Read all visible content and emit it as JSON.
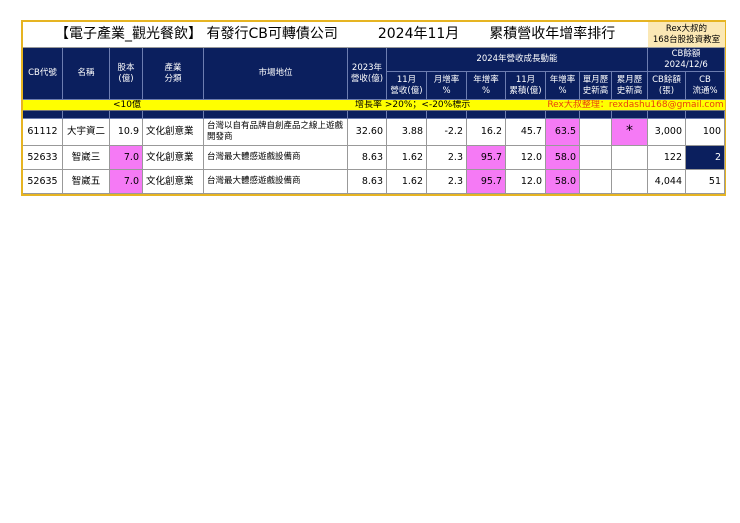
{
  "title": {
    "main": "【電子產業_觀光餐飲】 有發行CB可轉債公司",
    "period": "2024年11月",
    "subtitle": "累積營收年增率排行",
    "brand": "Rex大叔的\n168台股投資教室"
  },
  "headers": {
    "code": "CB代號",
    "name": "名稱",
    "capital": "股本\n(億)",
    "industry": "產業\n分類",
    "position": "市場地位",
    "rev2023": "2023年\n營收(億)",
    "group2024": "2024年營收成長動能",
    "cbgroup": "CB餘額\n2024/12/6",
    "nov_rev": "11月\n營收(億)",
    "mom": "月增率\n%",
    "yoy": "年增率\n%",
    "nov_cum": "11月\n累積(億)",
    "cum_yoy": "年增率\n%",
    "single_high": "單月歷\n史新高",
    "cum_high": "累月歷\n史新高",
    "cb_balance": "CB餘額\n(張)",
    "cb_float": "CB\n流通%"
  },
  "banner": {
    "capital_note": "<10億",
    "growth_note": "增長率 >20%；<-20%標示",
    "contact": "Rex大叔整理：rexdashu168@gmail.com"
  },
  "colors": {
    "navy": "#0b1f5e",
    "yellow": "#ffff00",
    "pink": "#f57af5",
    "gold": "#e6b422"
  },
  "rows": [
    {
      "code": "61112",
      "name": "大宇資二",
      "capital": "10.9",
      "industry": "文化創意業",
      "position": "台灣以自有品牌自創產品之線上遊戲開發商",
      "rev2023": "32.60",
      "nov_rev": "3.88",
      "mom": "-2.2",
      "yoy": "16.2",
      "nov_cum": "45.7",
      "cum_yoy": "63.5",
      "single_high": "",
      "cum_high": "*",
      "cb_balance": "3,000",
      "cb_float": "100"
    },
    {
      "code": "52633",
      "name": "智崴三",
      "capital": "7.0",
      "industry": "文化創意業",
      "position": "台灣最大體感遊戲設備商",
      "rev2023": "8.63",
      "nov_rev": "1.62",
      "mom": "2.3",
      "yoy": "95.7",
      "nov_cum": "12.0",
      "cum_yoy": "58.0",
      "single_high": "",
      "cum_high": "",
      "cb_balance": "122",
      "cb_float": "2"
    },
    {
      "code": "52635",
      "name": "智崴五",
      "capital": "7.0",
      "industry": "文化創意業",
      "position": "台灣最大體感遊戲設備商",
      "rev2023": "8.63",
      "nov_rev": "1.62",
      "mom": "2.3",
      "yoy": "95.7",
      "nov_cum": "12.0",
      "cum_yoy": "58.0",
      "single_high": "",
      "cum_high": "",
      "cb_balance": "4,044",
      "cb_float": "51"
    }
  ]
}
